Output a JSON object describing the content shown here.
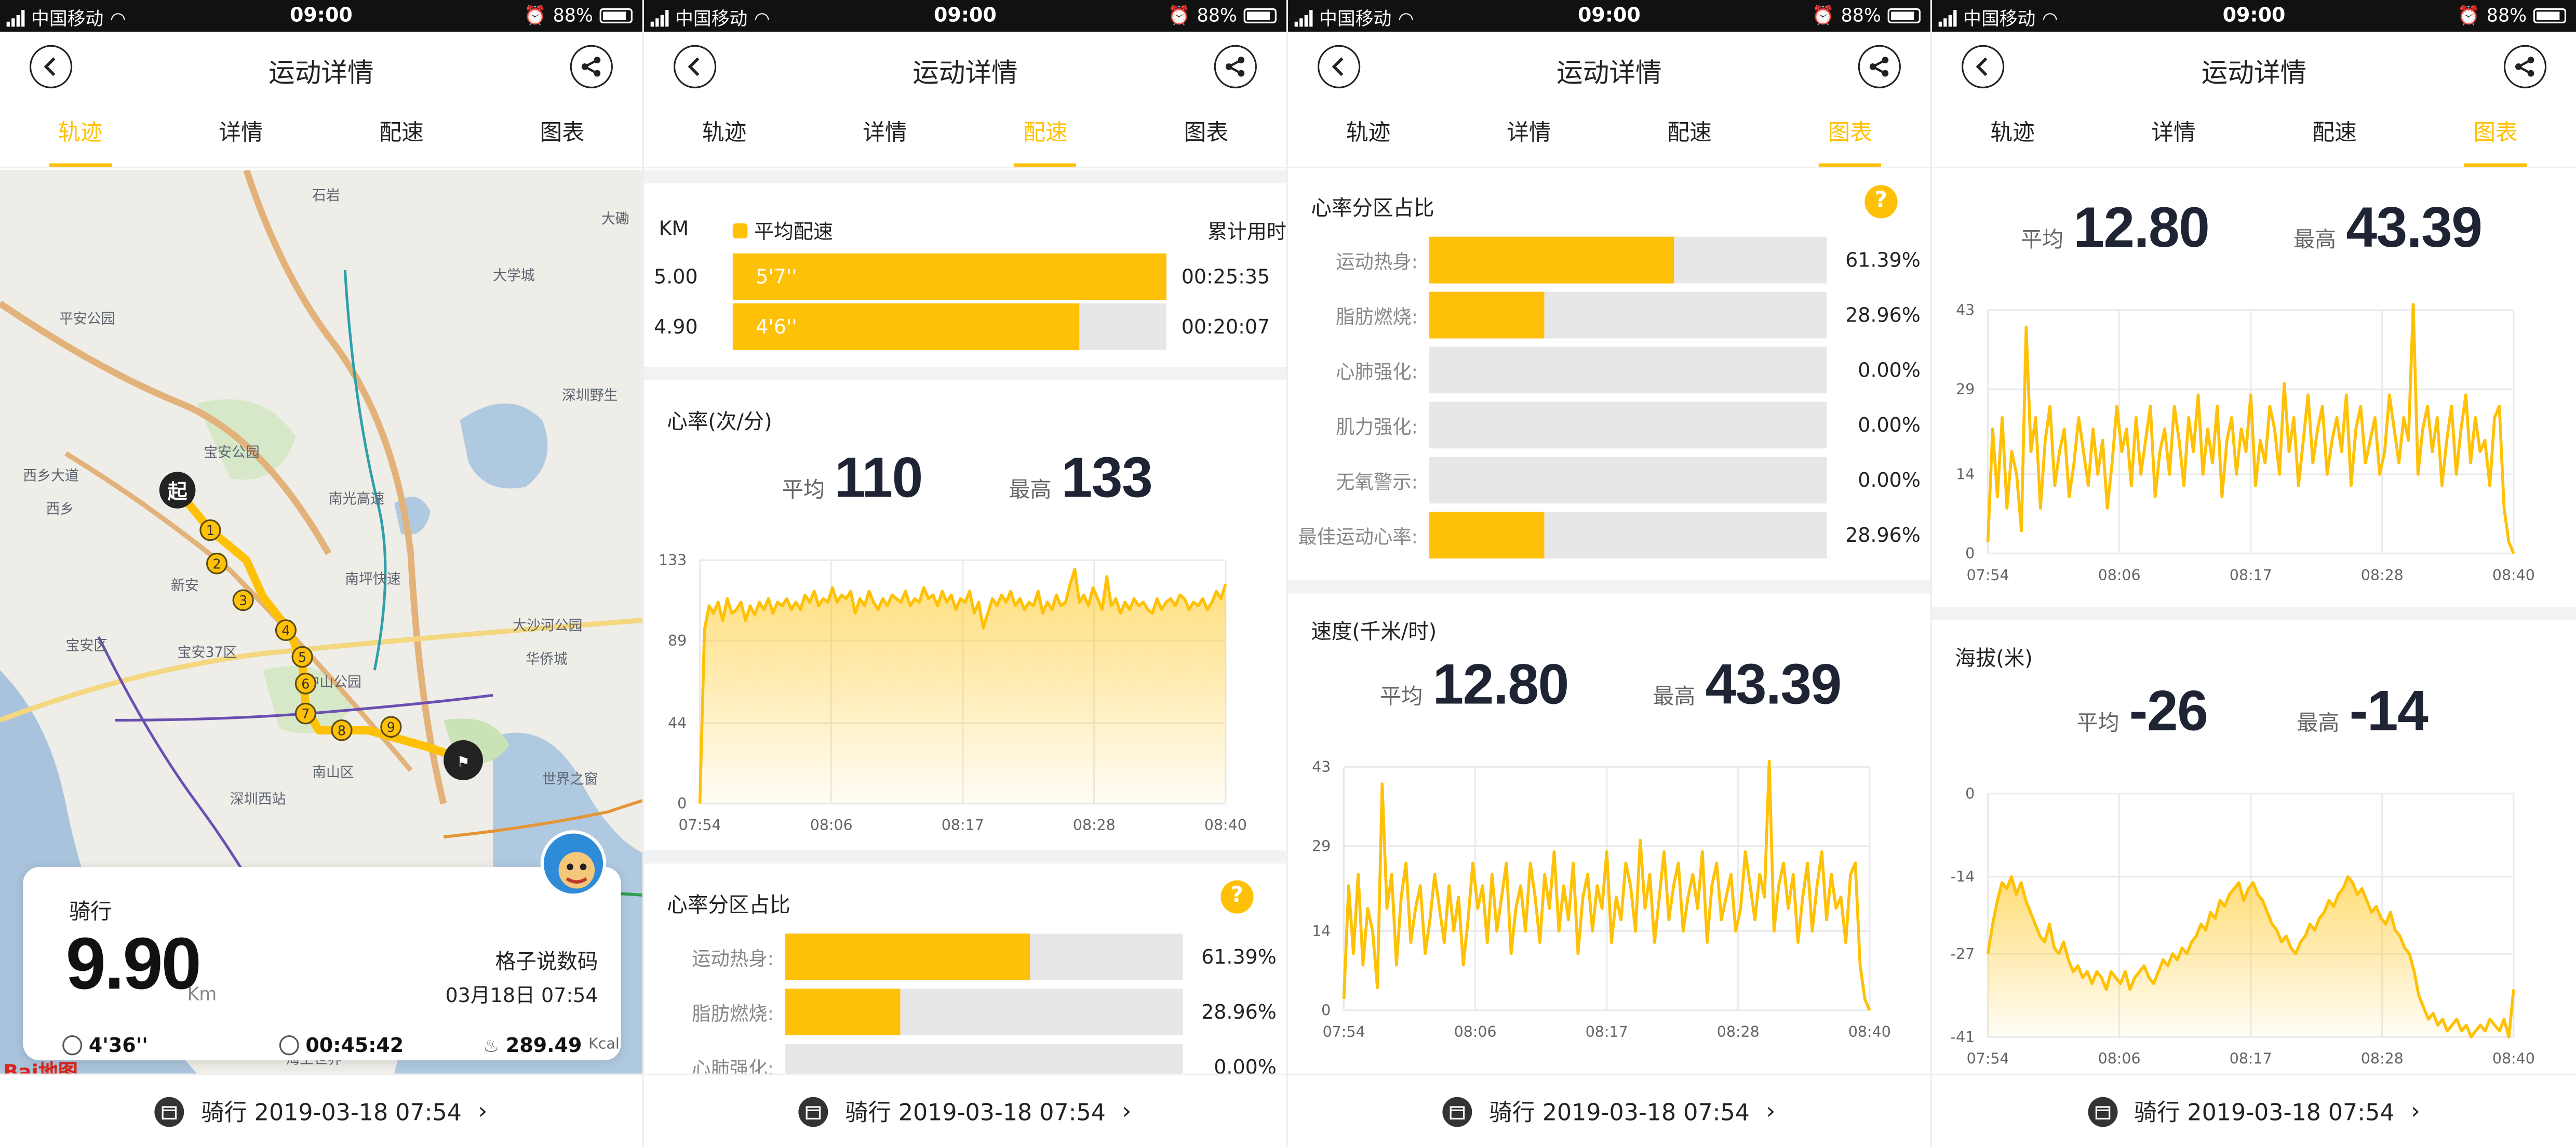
{
  "status": {
    "carrier": "中国移动",
    "time": "09:00",
    "battery": "88%"
  },
  "nav": {
    "title": "运动详情"
  },
  "tabs": [
    "轨迹",
    "详情",
    "配速",
    "图表"
  ],
  "bottom": {
    "label": "骑行 2019-03-18 07:54"
  },
  "colors": {
    "accent": "#FFC107",
    "ink": "#1E2433"
  },
  "track": {
    "activity": "骑行",
    "distance": "9.90",
    "distance_unit": "Km",
    "user": "格子说数码",
    "date": "03月18日 07:54",
    "pace": "4'36''",
    "duration": "00:45:42",
    "calories": "289.49",
    "calories_unit": "Kcal",
    "start_label": "起",
    "markers": [
      "1",
      "2",
      "3",
      "4",
      "5",
      "6",
      "7",
      "8",
      "9"
    ],
    "map_labels": [
      "西乡大道",
      "平安公园",
      "宝安公园",
      "西乡",
      "新安",
      "宝安区",
      "宝安37区",
      "南光高速",
      "南坪快速",
      "中山公园",
      "南山区",
      "深圳西站",
      "大沙河公园",
      "华侨城",
      "世界之窗",
      "深圳野生",
      "大磡",
      "石岩",
      "海上世界",
      "大学城"
    ],
    "map_logo": "Bai地图"
  },
  "pace": {
    "col_km": "KM",
    "col_avg": "平均配速",
    "col_cum": "累计用时",
    "rows": [
      {
        "km": "5.00",
        "pace": "5'7''",
        "fraction": 1.0,
        "cum": "00:25:35"
      },
      {
        "km": "4.90",
        "pace": "4'6''",
        "fraction": 0.8,
        "cum": "00:20:07"
      }
    ]
  },
  "heart": {
    "title": "心率(次/分)",
    "avg_label": "平均",
    "avg": "110",
    "max_label": "最高",
    "max": "133"
  },
  "zones": {
    "title": "心率分区占比",
    "help": "?",
    "rows": [
      {
        "name": "运动热身:",
        "pct": "61.39%",
        "value": 0.6139
      },
      {
        "name": "脂肪燃烧:",
        "pct": "28.96%",
        "value": 0.2896
      },
      {
        "name": "心肺强化:",
        "pct": "0.00%",
        "value": 0
      },
      {
        "name": "肌力强化:",
        "pct": "0.00%",
        "value": 0
      },
      {
        "name": "无氧警示:",
        "pct": "0.00%",
        "value": 0
      },
      {
        "name": "最佳运动心率:",
        "pct": "28.96%",
        "value": 0.2896
      }
    ]
  },
  "speed": {
    "title": "速度(千米/时)",
    "avg_label": "平均",
    "avg": "12.80",
    "max_label": "最高",
    "max": "43.39"
  },
  "altitude": {
    "title": "海拔(米)",
    "avg_label": "平均",
    "avg": "-26",
    "max_label": "最高",
    "max": "-14"
  },
  "chart_data": [
    {
      "type": "area",
      "title": "心率(次/分)",
      "x_ticks": [
        "07:54",
        "08:06",
        "08:17",
        "08:28",
        "08:40"
      ],
      "y_ticks": [
        0,
        44,
        89,
        133
      ],
      "ylim": [
        0,
        133
      ],
      "grid": true,
      "values": [
        0,
        95,
        108,
        104,
        110,
        100,
        112,
        104,
        106,
        110,
        100,
        108,
        103,
        110,
        106,
        112,
        104,
        110,
        108,
        112,
        106,
        110,
        106,
        114,
        110,
        116,
        108,
        112,
        110,
        118,
        110,
        114,
        112,
        116,
        104,
        112,
        108,
        116,
        110,
        106,
        112,
        108,
        114,
        112,
        110,
        116,
        108,
        112,
        110,
        118,
        112,
        114,
        108,
        116,
        110,
        114,
        106,
        112,
        110,
        116,
        104,
        110,
        96,
        104,
        112,
        108,
        114,
        110,
        116,
        108,
        112,
        106,
        110,
        108,
        116,
        104,
        110,
        106,
        114,
        108,
        110,
        120,
        128,
        110,
        114,
        108,
        118,
        112,
        106,
        124,
        108,
        112,
        104,
        110,
        106,
        112,
        108,
        110,
        106,
        104,
        112,
        106,
        110,
        112,
        108,
        114,
        112,
        106,
        110,
        108,
        112,
        106,
        110,
        116,
        112,
        120
      ]
    },
    {
      "type": "line",
      "title": "速度(千米/时)",
      "x_ticks": [
        "07:54",
        "08:06",
        "08:17",
        "08:28",
        "08:40"
      ],
      "y_ticks": [
        0,
        14,
        29,
        43
      ],
      "ylim": [
        0,
        43
      ],
      "grid": true,
      "values": [
        2,
        22,
        10,
        24,
        8,
        18,
        14,
        4,
        40,
        18,
        24,
        8,
        20,
        26,
        12,
        18,
        22,
        10,
        16,
        24,
        18,
        12,
        22,
        14,
        20,
        8,
        16,
        26,
        18,
        22,
        12,
        24,
        14,
        20,
        26,
        10,
        18,
        22,
        14,
        26,
        20,
        12,
        24,
        18,
        28,
        14,
        22,
        16,
        26,
        10,
        20,
        24,
        14,
        22,
        18,
        28,
        12,
        20,
        16,
        26,
        22,
        14,
        30,
        18,
        24,
        12,
        20,
        28,
        16,
        22,
        26,
        14,
        20,
        24,
        18,
        28,
        12,
        22,
        26,
        16,
        20,
        24,
        14,
        18,
        28,
        22,
        16,
        24,
        20,
        44,
        14,
        22,
        26,
        18,
        24,
        12,
        20,
        26,
        14,
        22,
        28,
        16,
        24,
        18,
        20,
        12,
        24,
        26,
        8,
        2,
        0
      ]
    },
    {
      "type": "area",
      "title": "海拔(米)",
      "x_ticks": [
        "07:54",
        "08:06",
        "08:17",
        "08:28",
        "08:40"
      ],
      "y_ticks": [
        0,
        -14,
        -27,
        -41
      ],
      "ylim": [
        -41,
        0
      ],
      "grid": true,
      "values": [
        -27,
        -22,
        -18,
        -15,
        -16,
        -14,
        -17,
        -15,
        -18,
        -20,
        -22,
        -24,
        -25,
        -22,
        -26,
        -27,
        -25,
        -28,
        -30,
        -29,
        -31,
        -30,
        -32,
        -30,
        -31,
        -33,
        -30,
        -31,
        -32,
        -30,
        -33,
        -31,
        -30,
        -29,
        -31,
        -32,
        -30,
        -28,
        -29,
        -27,
        -28,
        -26,
        -27,
        -25,
        -24,
        -22,
        -23,
        -20,
        -21,
        -18,
        -19,
        -17,
        -16,
        -15,
        -18,
        -16,
        -15,
        -17,
        -18,
        -20,
        -22,
        -23,
        -25,
        -24,
        -26,
        -27,
        -25,
        -24,
        -22,
        -23,
        -21,
        -20,
        -18,
        -19,
        -17,
        -16,
        -14,
        -15,
        -17,
        -16,
        -18,
        -20,
        -19,
        -21,
        -22,
        -20,
        -23,
        -24,
        -26,
        -27,
        -30,
        -34,
        -36,
        -38,
        -37,
        -39,
        -38,
        -40,
        -39,
        -38,
        -40,
        -39,
        -41,
        -40,
        -39,
        -40,
        -38,
        -39,
        -40,
        -38,
        -41,
        -33
      ]
    }
  ]
}
